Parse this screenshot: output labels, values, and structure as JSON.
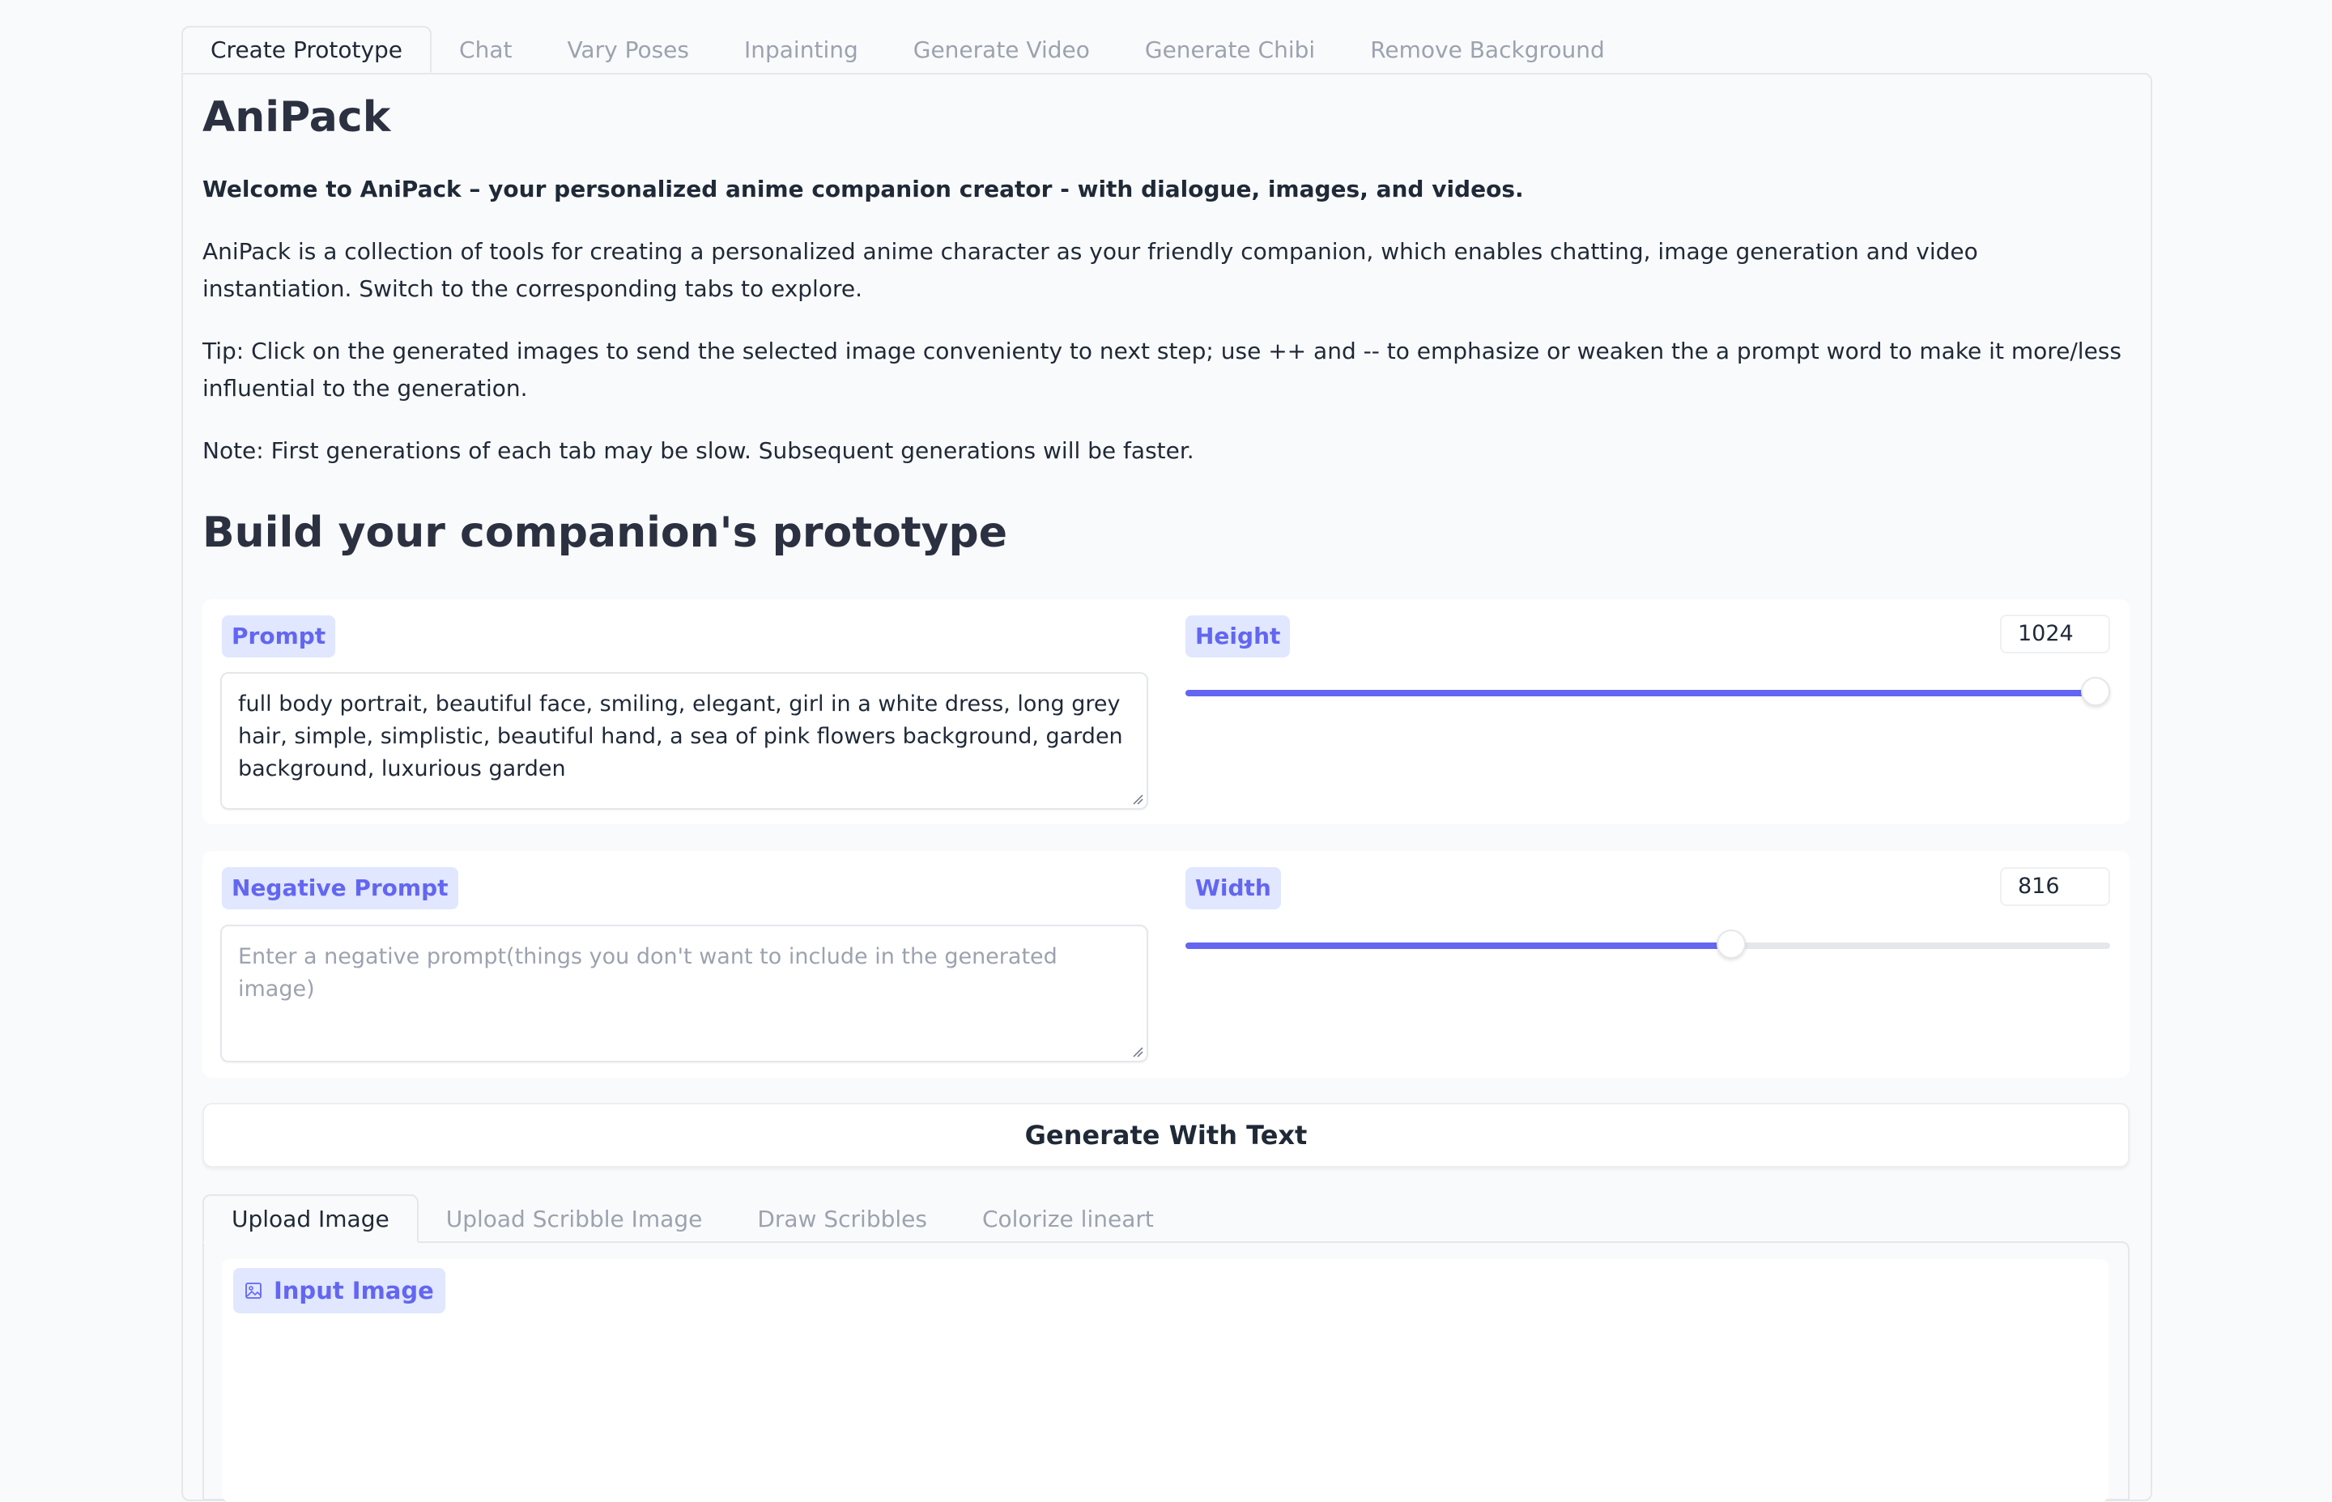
{
  "tabs": [
    {
      "label": "Create Prototype",
      "active": true
    },
    {
      "label": "Chat"
    },
    {
      "label": "Vary Poses"
    },
    {
      "label": "Inpainting"
    },
    {
      "label": "Generate Video"
    },
    {
      "label": "Generate Chibi"
    },
    {
      "label": "Remove Background"
    }
  ],
  "header": {
    "title": "AniPack",
    "welcome": "Welcome to AniPack – your personalized anime companion creator - with dialogue, images, and videos.",
    "description": "AniPack is a collection of tools for creating a personalized anime character as your friendly companion, which enables chatting, image generation and video instantiation. Switch to the corresponding tabs to explore.",
    "tip": "Tip: Click on the generated images to send the selected image convenienty to next step; use ++ and -- to emphasize or weaken the a prompt word to make it more/less influential to the generation.",
    "note": "Note: First generations of each tab may be slow. Subsequent generations will be faster."
  },
  "section": {
    "title": "Build your companion's prototype"
  },
  "prompt": {
    "label": "Prompt",
    "value": "full body portrait, beautiful face, smiling, elegant, girl in a white dress, long grey hair, simple, simplistic, beautiful hand, a sea of pink flowers background, garden background, luxurious garden"
  },
  "negative_prompt": {
    "label": "Negative Prompt",
    "value": "",
    "placeholder": "Enter a negative prompt(things you don't want to include in the generated image)"
  },
  "height": {
    "label": "Height",
    "value": "1024",
    "fraction": 0.984
  },
  "width": {
    "label": "Width",
    "value": "816",
    "fraction": 0.59
  },
  "generate_button": {
    "label": "Generate With Text"
  },
  "subtabs": [
    {
      "label": "Upload Image",
      "active": true
    },
    {
      "label": "Upload Scribble Image"
    },
    {
      "label": "Draw Scribbles"
    },
    {
      "label": "Colorize lineart"
    }
  ],
  "input_image": {
    "label": "Input Image",
    "icon": "image-icon"
  },
  "colors": {
    "accent": "#6366f1",
    "badge_bg": "#e0e7ff",
    "page_bg": "#f9fafb"
  }
}
